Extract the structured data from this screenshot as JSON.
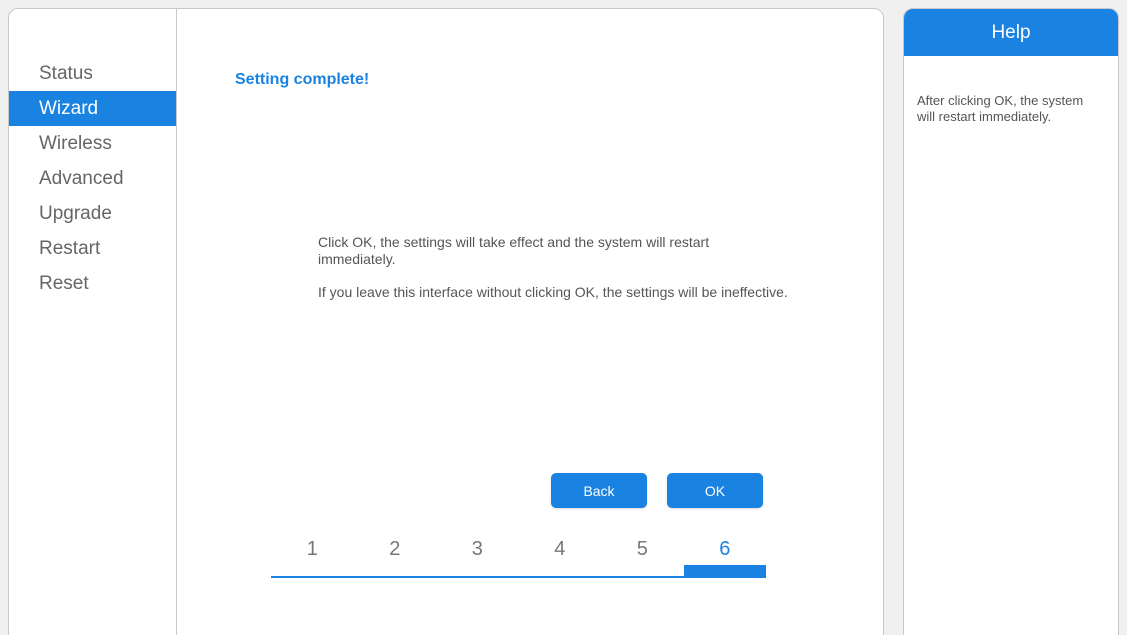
{
  "sidebar": {
    "items": [
      {
        "label": "Status"
      },
      {
        "label": "Wizard"
      },
      {
        "label": "Wireless"
      },
      {
        "label": "Advanced"
      },
      {
        "label": "Upgrade"
      },
      {
        "label": "Restart"
      },
      {
        "label": "Reset"
      }
    ],
    "active_label": "Wizard"
  },
  "main": {
    "title": "Setting complete!",
    "message_1": "Click OK, the settings will take effect and the system will restart immediately.",
    "message_2": "If you leave this interface without clicking OK, the settings will be ineffective.",
    "back_label": "Back",
    "ok_label": "OK"
  },
  "stepper": {
    "steps": [
      "1",
      "2",
      "3",
      "4",
      "5",
      "6"
    ],
    "current_step": 6,
    "total_steps": 6
  },
  "help": {
    "title": "Help",
    "text": "After clicking OK, the system will restart immediately."
  },
  "colors": {
    "accent": "#1a83e2",
    "text": "#666666",
    "border": "#c8c8c8",
    "background": "#f0f0f0"
  }
}
